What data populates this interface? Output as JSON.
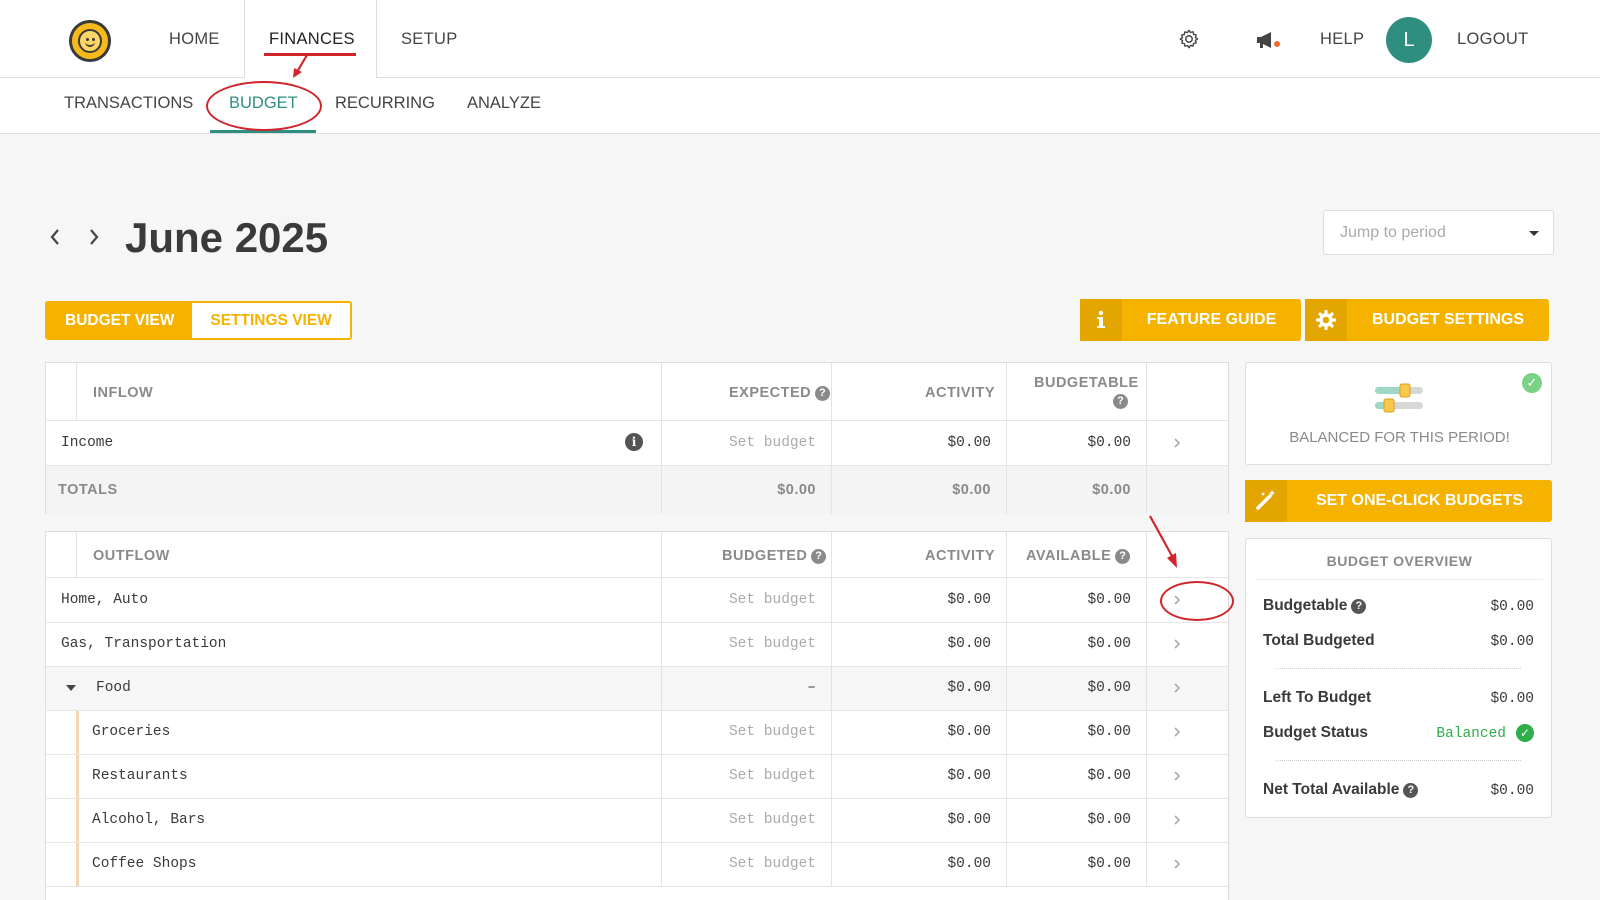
{
  "topnav": {
    "home": "HOME",
    "finances": "FINANCES",
    "setup": "SETUP",
    "help": "HELP",
    "avatar_letter": "L",
    "logout": "LOGOUT"
  },
  "subnav": {
    "transactions": "TRANSACTIONS",
    "budget": "BUDGET",
    "recurring": "RECURRING",
    "analyze": "ANALYZE"
  },
  "period": {
    "title": "June 2025",
    "jump_placeholder": "Jump to period"
  },
  "view_toggle": {
    "budget_view": "BUDGET VIEW",
    "settings_view": "SETTINGS VIEW"
  },
  "actions": {
    "feature_guide": "FEATURE GUIDE",
    "budget_settings": "BUDGET SETTINGS",
    "one_click": "SET ONE-CLICK BUDGETS"
  },
  "inflow": {
    "headers": {
      "name": "INFLOW",
      "expected": "EXPECTED",
      "activity": "ACTIVITY",
      "budgetable": "BUDGETABLE"
    },
    "rows": [
      {
        "name": "Income",
        "expected": "Set budget",
        "activity": "$0.00",
        "budgetable": "$0.00"
      }
    ],
    "totals": {
      "label": "TOTALS",
      "expected": "$0.00",
      "activity": "$0.00",
      "budgetable": "$0.00"
    }
  },
  "outflow": {
    "headers": {
      "name": "OUTFLOW",
      "budgeted": "BUDGETED",
      "activity": "ACTIVITY",
      "available": "AVAILABLE"
    },
    "rows": [
      {
        "name": "Home, Auto",
        "budgeted": "Set budget",
        "activity": "$0.00",
        "available": "$0.00"
      },
      {
        "name": "Gas, Transportation",
        "budgeted": "Set budget",
        "activity": "$0.00",
        "available": "$0.00"
      },
      {
        "name": "Food",
        "budgeted": "–",
        "activity": "$0.00",
        "available": "$0.00"
      },
      {
        "name": "Groceries",
        "budgeted": "Set budget",
        "activity": "$0.00",
        "available": "$0.00"
      },
      {
        "name": "Restaurants",
        "budgeted": "Set budget",
        "activity": "$0.00",
        "available": "$0.00"
      },
      {
        "name": "Alcohol, Bars",
        "budgeted": "Set budget",
        "activity": "$0.00",
        "available": "$0.00"
      },
      {
        "name": "Coffee Shops",
        "budgeted": "Set budget",
        "activity": "$0.00",
        "available": "$0.00"
      }
    ]
  },
  "sidebar": {
    "balanced_text": "BALANCED FOR THIS PERIOD!",
    "overview": {
      "title": "BUDGET OVERVIEW",
      "budgetable_label": "Budgetable",
      "budgetable_value": "$0.00",
      "total_budgeted_label": "Total Budgeted",
      "total_budgeted_value": "$0.00",
      "left_label": "Left To Budget",
      "left_value": "$0.00",
      "status_label": "Budget Status",
      "status_value": "Balanced",
      "net_label": "Net Total Available",
      "net_value": "$0.00"
    }
  },
  "colors": {
    "accent": "#f5b300",
    "teal": "#2e8f80",
    "annotation": "#d0252b",
    "success": "#2fae4c"
  }
}
